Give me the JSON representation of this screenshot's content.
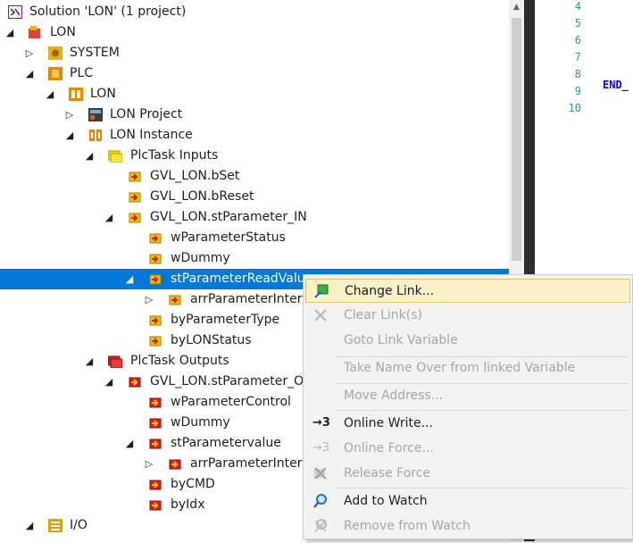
{
  "tree": {
    "items": [
      {
        "label": "Solution 'LON' (1 project)",
        "icon": "solution-icon",
        "arrow": ""
      },
      {
        "label": "LON",
        "icon": "project-icon",
        "arrow": "expanded"
      },
      {
        "label": "SYSTEM",
        "icon": "system-icon",
        "arrow": "collapsed"
      },
      {
        "label": "PLC",
        "icon": "plc-icon",
        "arrow": "expanded"
      },
      {
        "label": "LON",
        "icon": "plc-project-icon",
        "arrow": "expanded"
      },
      {
        "label": "LON Project",
        "icon": "plc-module-icon",
        "arrow": "collapsed"
      },
      {
        "label": "LON Instance",
        "icon": "instance-icon",
        "arrow": "expanded"
      },
      {
        "label": "PlcTask Inputs",
        "icon": "input-folder-icon",
        "arrow": "expanded"
      },
      {
        "label": "GVL_LON.bSet",
        "icon": "linked-variable-icon",
        "arrow": ""
      },
      {
        "label": "GVL_LON.bReset",
        "icon": "linked-variable-icon",
        "arrow": ""
      },
      {
        "label": "GVL_LON.stParameter_IN",
        "icon": "linked-variable-icon",
        "arrow": "expanded"
      },
      {
        "label": "wParameterStatus",
        "icon": "linked-variable-icon",
        "arrow": ""
      },
      {
        "label": "wDummy",
        "icon": "input-variable-icon",
        "arrow": ""
      },
      {
        "label": "stParameterReadValue",
        "icon": "input-variable-icon",
        "arrow": "expanded"
      },
      {
        "label": "arrParameterInterface",
        "icon": "input-variable-icon",
        "arrow": "collapsed"
      },
      {
        "label": "byParameterType",
        "icon": "input-variable-icon",
        "arrow": ""
      },
      {
        "label": "byLONStatus",
        "icon": "input-variable-icon",
        "arrow": ""
      },
      {
        "label": "PlcTask Outputs",
        "icon": "output-folder-icon",
        "arrow": "expanded"
      },
      {
        "label": "GVL_LON.stParameter_OUT",
        "icon": "output-variable-icon",
        "arrow": "expanded"
      },
      {
        "label": "wParameterControl",
        "icon": "output-variable-icon",
        "arrow": ""
      },
      {
        "label": "wDummy",
        "icon": "output-variable-icon",
        "arrow": ""
      },
      {
        "label": "stParametervalue",
        "icon": "output-variable-icon",
        "arrow": "expanded"
      },
      {
        "label": "arrParameterInterface",
        "icon": "output-variable-icon",
        "arrow": "collapsed"
      },
      {
        "label": "byCMD",
        "icon": "output-variable-icon",
        "arrow": ""
      },
      {
        "label": "byIdx",
        "icon": "output-variable-icon",
        "arrow": ""
      },
      {
        "label": "I/O",
        "icon": "io-icon",
        "arrow": "expanded"
      }
    ],
    "selected_label": "stParameterReadValue"
  },
  "editor": {
    "line_numbers": [
      "4",
      "5",
      "6",
      "7",
      "8",
      "9",
      "10"
    ],
    "keyword": "END_"
  },
  "context_menu": {
    "items": [
      {
        "label": "Change Link...",
        "icon": "change-link-icon",
        "enabled": true,
        "highlighted": true
      },
      {
        "label": "Clear Link(s)",
        "icon": "clear-link-icon",
        "enabled": false
      },
      {
        "label": "Goto Link Variable",
        "icon": "",
        "enabled": false
      },
      {
        "label": "Take Name Over from linked Variable",
        "icon": "",
        "enabled": false
      },
      {
        "label": "Move Address...",
        "icon": "",
        "enabled": false
      },
      {
        "label": "Online Write...",
        "icon": "online-write-icon",
        "enabled": true
      },
      {
        "label": "Online Force...",
        "icon": "online-force-icon",
        "enabled": false
      },
      {
        "label": "Release Force",
        "icon": "release-force-icon",
        "enabled": false
      },
      {
        "label": "Add to Watch",
        "icon": "add-watch-icon",
        "enabled": true
      },
      {
        "label": "Remove from Watch",
        "icon": "remove-watch-icon",
        "enabled": false
      }
    ]
  },
  "colors": {
    "selection": "#0078d7",
    "menu_highlight": "#fbf1c6",
    "input_folder": "#f5d800",
    "output_folder": "#d41f1f"
  }
}
